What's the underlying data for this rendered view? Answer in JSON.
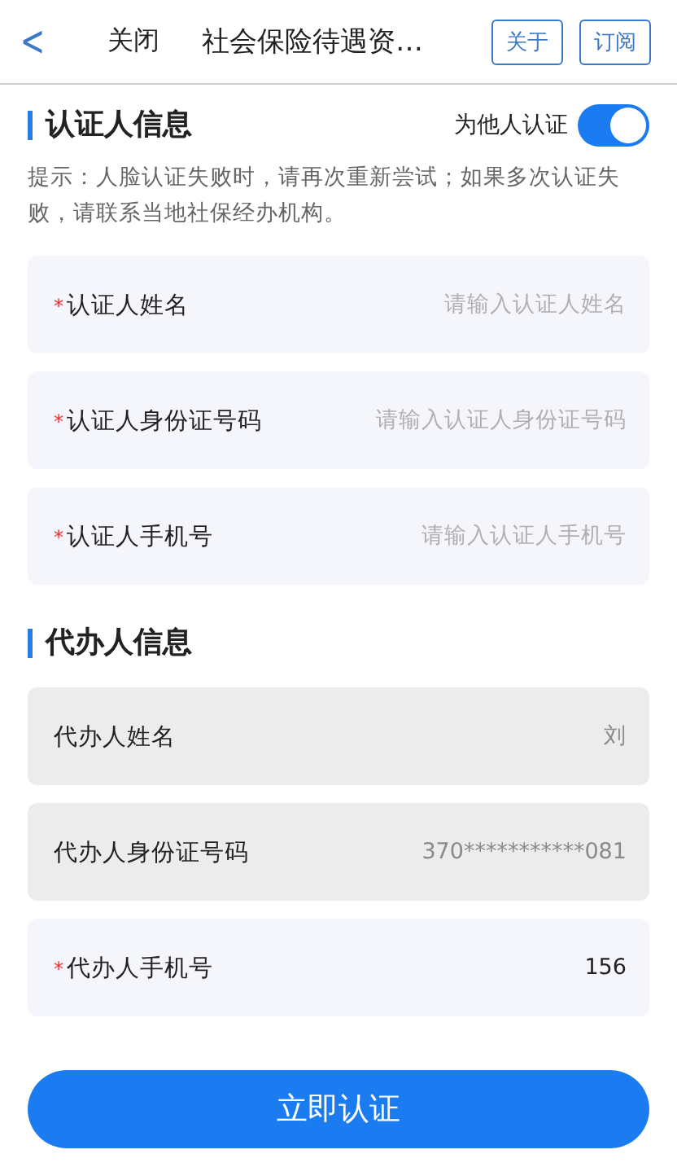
{
  "nav": {
    "back": "<",
    "close": "关闭",
    "title": "社会保险待遇资…",
    "buttons": [
      "关于",
      "订阅"
    ]
  },
  "sections": [
    {
      "title": "认证人信息",
      "toggle": {
        "label": "为他人认证",
        "on": true
      },
      "hint": "提示：人脸认证失败时，请再次重新尝试；如果多次认证失败，请联系当地社保经办机构。",
      "fields": [
        {
          "label": "认证人姓名",
          "mark": "*",
          "disabled": false,
          "placeholder": "请输入认证人姓名"
        },
        {
          "label": "认证人身份证号码",
          "mark": "*",
          "disabled": false,
          "placeholder": "请输入认证人身份证号码"
        },
        {
          "label": "认证人手机号",
          "mark": "*",
          "disabled": false,
          "placeholder": "请输入认证人手机号"
        }
      ]
    },
    {
      "title": "代办人信息",
      "fields": [
        {
          "label": "代办人姓名",
          "disabled": true,
          "value": "刘"
        },
        {
          "label": "代办人身份证号码",
          "disabled": true,
          "value": "370***********081"
        },
        {
          "label": "代办人手机号",
          "mark": "*",
          "disabled": false,
          "value": "156"
        }
      ]
    }
  ],
  "submit": "立即认证"
}
